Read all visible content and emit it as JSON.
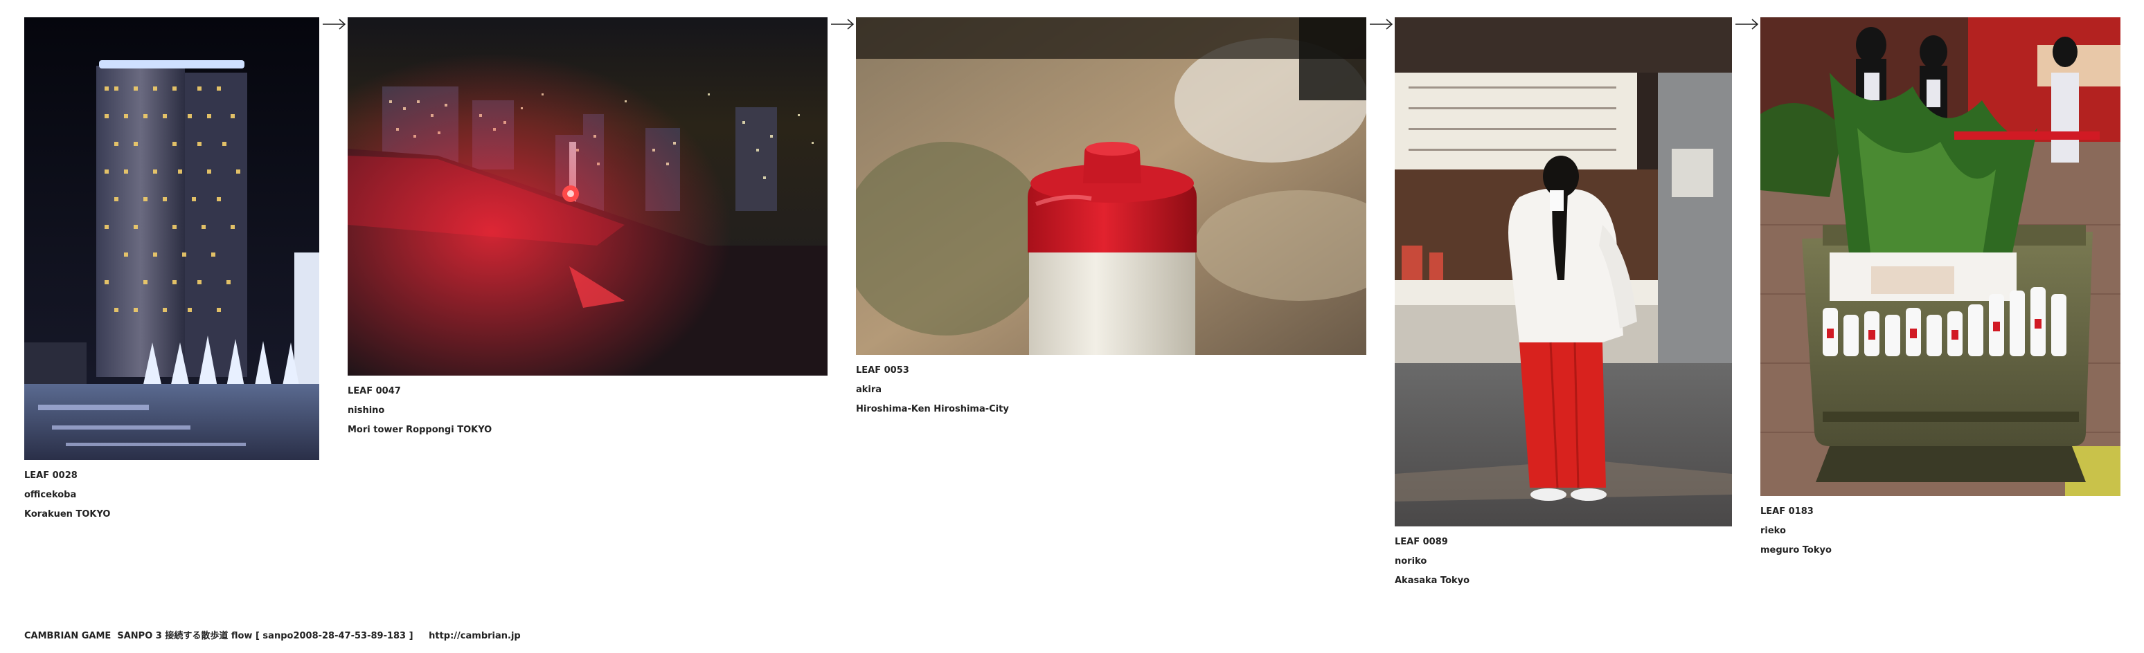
{
  "leaves": [
    {
      "id": "LEAF 0028",
      "author": "officekoba",
      "location": "Korakuen TOKYO",
      "alt": "Night view of a lit skyscraper with illuminated trees"
    },
    {
      "id": "LEAF 0047",
      "author": "nishino",
      "location": "Mori tower Roppongi TOKYO",
      "alt": "Night city view from a rooftop with red lights"
    },
    {
      "id": "LEAF 0053",
      "author": "akira",
      "location": "Hiroshima-Ken Hiroshima-City",
      "alt": "Close-up of a bottle with a red cap on a table"
    },
    {
      "id": "LEAF 0089",
      "author": "noriko",
      "location": "Akasaka Tokyo",
      "alt": "Shrine maiden in white and red robes at a shrine"
    },
    {
      "id": "LEAF 0183",
      "author": "rieko",
      "location": "meguro Tokyo",
      "alt": "Wooden cart loaded with sake bottles and greenery at a festival"
    }
  ],
  "arrow_icon": "arrow-right-icon",
  "footer": {
    "title": "CAMBRIAN GAME  SANPO 3 接続する散歩道 flow [ sanpo2008-28-47-53-89-183 ]",
    "url": "http://cambrian.jp"
  },
  "colors": {
    "text": "#222222",
    "accent_red": "#d11a24"
  }
}
